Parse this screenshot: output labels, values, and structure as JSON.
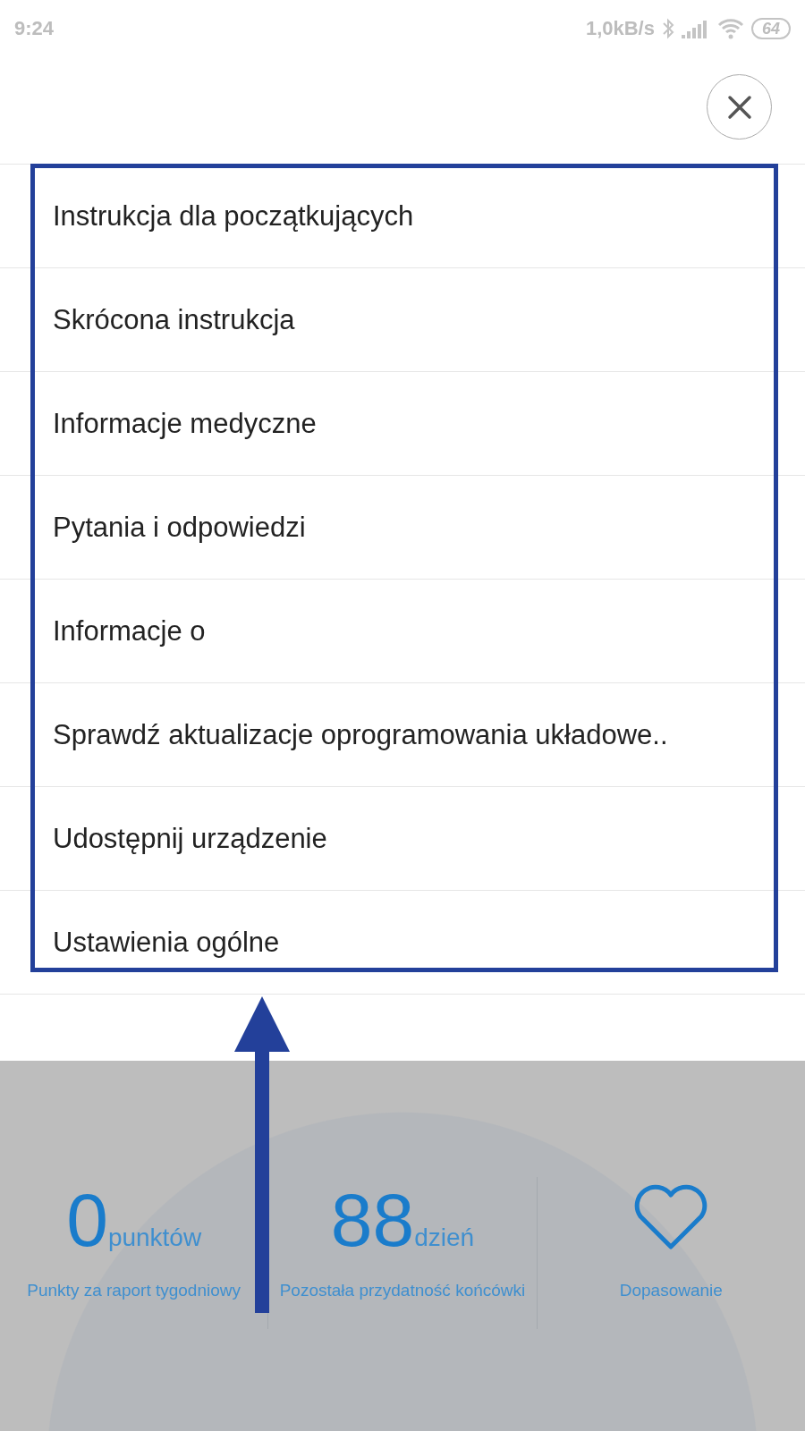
{
  "status_bar": {
    "time": "9:24",
    "speed": "1,0kB/s",
    "battery": "64"
  },
  "menu": {
    "items": [
      {
        "label": "Instrukcja dla początkujących"
      },
      {
        "label": "Skrócona instrukcja"
      },
      {
        "label": "Informacje medyczne"
      },
      {
        "label": "Pytania i odpowiedzi"
      },
      {
        "label": "Informacje o"
      },
      {
        "label": "Sprawdź aktualizacje oprogramowania układowe.."
      },
      {
        "label": "Udostępnij urządzenie"
      },
      {
        "label": "Ustawienia ogólne"
      }
    ]
  },
  "stats": [
    {
      "kind": "number",
      "value": "0",
      "unit": "punktów",
      "caption": "Punkty za raport tygodniowy"
    },
    {
      "kind": "number",
      "value": "88",
      "unit": "dzień",
      "caption": "Pozostała przydatność końcówki"
    },
    {
      "kind": "heart",
      "caption": "Dopasowanie"
    }
  ]
}
